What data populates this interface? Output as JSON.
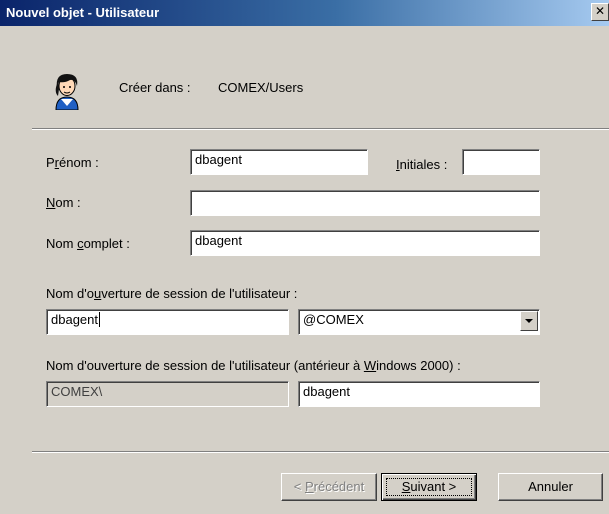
{
  "window": {
    "title": "Nouvel objet - Utilisateur",
    "close_symbol": "✕"
  },
  "header": {
    "icon": "user-icon",
    "create_in_label": "Créer dans :",
    "create_in_value": "COMEX/Users"
  },
  "form": {
    "first_name": {
      "label_pre": "P",
      "label_accel": "r",
      "label_post": "énom :",
      "value": "dbagent"
    },
    "initials": {
      "label_accel": "I",
      "label_post": "nitiales :",
      "value": ""
    },
    "last_name": {
      "label_accel": "N",
      "label_post": "om :",
      "value": ""
    },
    "full_name": {
      "label_pre": "Nom ",
      "label_accel": "c",
      "label_post": "omplet :",
      "value": "dbagent"
    },
    "logon_name": {
      "label_pre": "Nom d'o",
      "label_accel": "u",
      "label_post": "verture de session de l'utilisateur :",
      "value": "dbagent",
      "domain_selected": "@COMEX"
    },
    "logon_name_pre2000": {
      "label_pre": "Nom d'ouverture de session de l'utilisateur (antérieur à ",
      "label_accel": "W",
      "label_post": "indows 2000) :",
      "domain_value": "COMEX\\",
      "value": "dbagent"
    }
  },
  "buttons": {
    "back": {
      "pre": "< ",
      "accel": "P",
      "post": "récédent"
    },
    "next": {
      "accel": "S",
      "post": "uivant >"
    },
    "cancel": "Annuler"
  },
  "colors": {
    "titlebar_start": "#0a246a",
    "titlebar_end": "#a6caf0",
    "face": "#d4d0c8"
  }
}
